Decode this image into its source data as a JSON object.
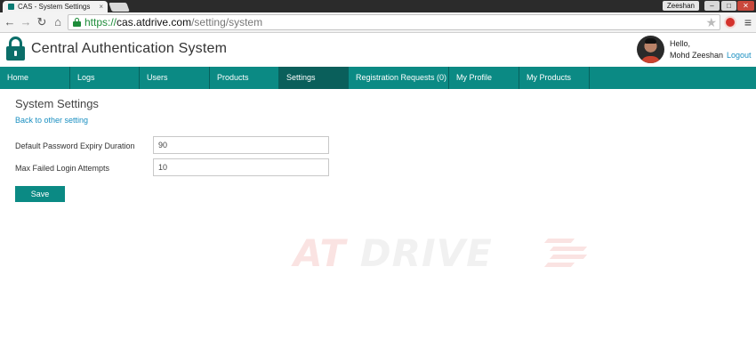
{
  "browser": {
    "tab_title": "CAS - System Settings",
    "tab_close": "×",
    "profile_name": "Zeeshan",
    "url_scheme": "https://",
    "url_host": "cas.atdrive.com",
    "url_path": "/setting/system"
  },
  "header": {
    "app_title": "Central Authentication System",
    "greeting": "Hello,",
    "username": "Mohd Zeeshan",
    "logout": "Logout"
  },
  "nav": {
    "items": [
      {
        "label": "Home",
        "active": false
      },
      {
        "label": "Logs",
        "active": false
      },
      {
        "label": "Users",
        "active": false
      },
      {
        "label": "Products",
        "active": false
      },
      {
        "label": "Settings",
        "active": true
      },
      {
        "label": "Registration Requests (0)",
        "active": false
      },
      {
        "label": "My Profile",
        "active": false
      },
      {
        "label": "My Products",
        "active": false
      }
    ]
  },
  "content": {
    "page_title": "System Settings",
    "back_link": "Back to other setting",
    "fields": [
      {
        "label": "Default Password Expiry Duration",
        "value": "90"
      },
      {
        "label": "Max Failed Login Attempts",
        "value": "10"
      }
    ],
    "save_label": "Save"
  },
  "watermark": {
    "part1": "AT",
    "part2": "DRIVE"
  },
  "colors": {
    "accent": "#0b8a84",
    "accent_dark": "#0a5f5b",
    "link": "#1a8fc1"
  }
}
